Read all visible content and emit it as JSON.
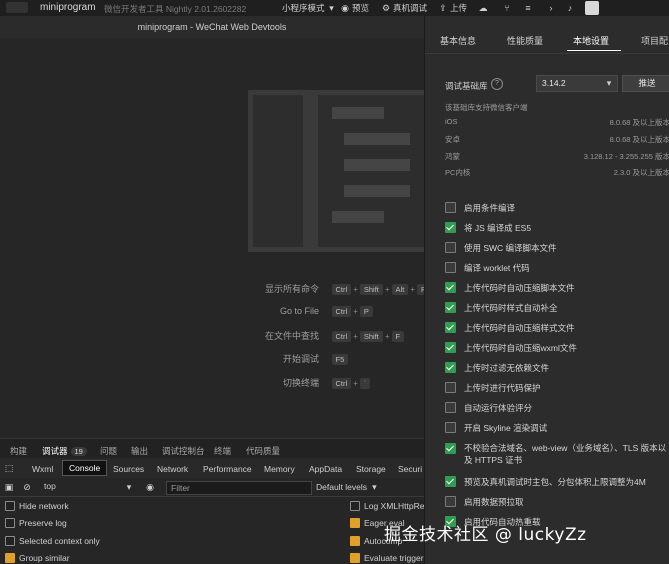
{
  "topbar": {
    "app_title": "miniprogram",
    "subtitle": "微信开发者工具 Nightly 2.01.2602282",
    "mode_label": "小程序模式",
    "preview_label": "预览",
    "remote_debug_label": "真机调试",
    "upload_label": "上传"
  },
  "window_title": "miniprogram - WeChat Web Devtools",
  "shortcuts": [
    {
      "label": "显示所有命令",
      "keys": [
        "Ctrl",
        "Shift",
        "Alt",
        "P"
      ]
    },
    {
      "label": "Go to File",
      "keys": [
        "Ctrl",
        "P"
      ]
    },
    {
      "label": "在文件中查找",
      "keys": [
        "Ctrl",
        "Shift",
        "F"
      ]
    },
    {
      "label": "开始调试",
      "keys": [
        "F5"
      ]
    },
    {
      "label": "切换终端",
      "keys": [
        "Ctrl",
        "`"
      ]
    }
  ],
  "panel_tabs": [
    {
      "label": "构建"
    },
    {
      "label": "调试器",
      "badge": "19"
    },
    {
      "label": "问题"
    },
    {
      "label": "输出"
    },
    {
      "label": "调试控制台"
    },
    {
      "label": "终端"
    },
    {
      "label": "代码质量"
    }
  ],
  "devtools_tabs": [
    "Wxml",
    "Console",
    "Sources",
    "Network",
    "Performance",
    "Memory",
    "AppData",
    "Storage",
    "Securi"
  ],
  "console": {
    "context": "top",
    "filter_placeholder": "Filter",
    "levels": "Default levels",
    "options_left": [
      {
        "label": "Hide network",
        "checked": false
      },
      {
        "label": "Preserve log",
        "checked": false
      },
      {
        "label": "Selected context only",
        "checked": false
      },
      {
        "label": "Group similar",
        "checked": true
      }
    ],
    "options_right": [
      {
        "label": "Log XMLHttpReq",
        "checked": false
      },
      {
        "label": "Eager eval",
        "checked": true
      },
      {
        "label": "Autocomp",
        "checked": true
      },
      {
        "label": "Evaluate triggers",
        "checked": true
      }
    ]
  },
  "details": {
    "tabs": [
      "基本信息",
      "性能质量",
      "本地设置",
      "项目配"
    ],
    "active_tab": 2,
    "base_lib_label": "调试基础库",
    "base_lib_value": "3.14.2",
    "push_label": "推送",
    "support_note": "该基础库支持微信客户端",
    "platforms": [
      {
        "name": "iOS",
        "value": "8.0.68 及以上版本"
      },
      {
        "name": "安卓",
        "value": "8.0.68 及以上版本"
      },
      {
        "name": "鸿蒙",
        "value": "3.128.12 - 3.255.255 版本"
      },
      {
        "name": "PC内核",
        "value": "2.3.0 及以上版本"
      }
    ],
    "settings": [
      {
        "label": "启用条件编译",
        "checked": false
      },
      {
        "label": "将 JS 编译成 ES5",
        "checked": true
      },
      {
        "label": "使用 SWC 编译脚本文件",
        "checked": false
      },
      {
        "label": "编译 worklet 代码",
        "checked": false
      },
      {
        "label": "上传代码时自动压缩脚本文件",
        "checked": true
      },
      {
        "label": "上传代码时样式自动补全",
        "checked": true
      },
      {
        "label": "上传代码时自动压缩样式文件",
        "checked": true
      },
      {
        "label": "上传代码时自动压缩wxml文件",
        "checked": true
      },
      {
        "label": "上传时过滤无依赖文件",
        "checked": true
      },
      {
        "label": "上传时进行代码保护",
        "checked": false
      },
      {
        "label": "自动运行体验评分",
        "checked": false
      },
      {
        "label": "开启 Skyline 渲染调试",
        "checked": false
      },
      {
        "label": "不校验合法域名、web-view（业务域名）、TLS 版本以及 HTTPS 证书",
        "checked": true
      },
      {
        "label": "预览及真机调试时主包、分包体积上限调整为4M",
        "checked": true
      },
      {
        "label": "启用数据预拉取",
        "checked": false
      },
      {
        "label": "启用代码自动热重载",
        "checked": true
      }
    ]
  },
  "watermark": "掘金技术社区 @ luckyZz",
  "colors": {
    "accent_check": "#2f9e51",
    "console_check": "#e0a02a"
  }
}
